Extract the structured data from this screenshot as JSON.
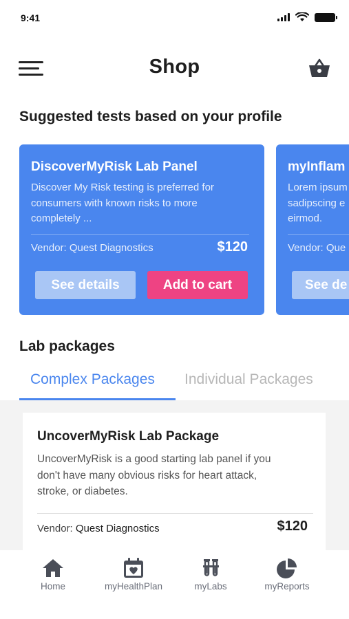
{
  "status_bar": {
    "time": "9:41"
  },
  "header": {
    "title": "Shop",
    "menu_icon": "hamburger-menu-icon",
    "cart_icon": "basket-icon"
  },
  "suggested": {
    "heading": "Suggested tests based on your profile",
    "cards": [
      {
        "title": "DiscoverMyRisk Lab Panel",
        "description": "Discover My Risk testing is preferred for\nconsumers with known risks to more\ncompletely ...",
        "vendor": "Vendor: Quest Diagnostics",
        "price": "$120",
        "details_label": "See details",
        "cart_label": "Add to cart"
      },
      {
        "title": "myInflam",
        "description": "Lorem ipsum\nsadipscing e\neirmod.",
        "vendor": "Vendor: Que",
        "details_label": "See de"
      }
    ]
  },
  "lab_packages": {
    "heading": "Lab packages",
    "tabs": [
      {
        "label": "Complex Packages",
        "active": true
      },
      {
        "label": "Individual Packages",
        "active": false
      }
    ],
    "package": {
      "title": "UncoverMyRisk Lab Package",
      "description": "UncoverMyRisk is a good starting lab panel if you\ndon't have many obvious risks for heart attack,\nstroke, or diabetes.",
      "vendor_label": "Vendor:",
      "vendor_name": "Quest Diagnostics",
      "price": "$120"
    }
  },
  "bottom_nav": [
    {
      "label": "Home",
      "icon": "home-icon"
    },
    {
      "label": "myHealthPlan",
      "icon": "calendar-heart-icon"
    },
    {
      "label": "myLabs",
      "icon": "test-tubes-icon"
    },
    {
      "label": "myReports",
      "icon": "pie-chart-icon"
    }
  ],
  "colors": {
    "primary_blue": "#4a86ee",
    "accent_pink": "#ee4383",
    "muted_button": "#a9c6f5",
    "nav_gray": "#6b6f7a"
  }
}
